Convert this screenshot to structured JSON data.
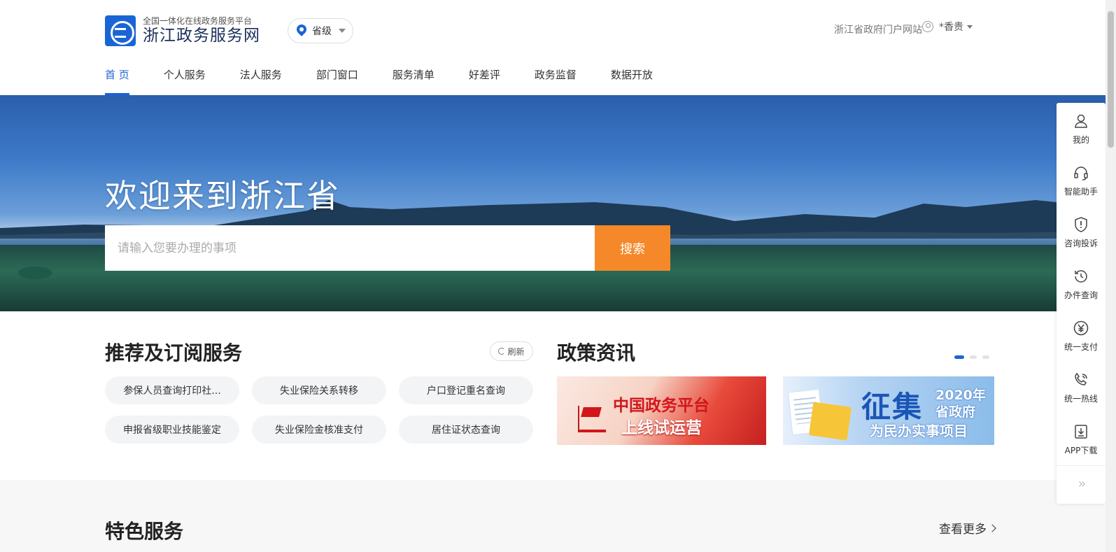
{
  "header": {
    "logo_sub": "全国一体化在线政务服务平台",
    "logo_main": "浙江政务服务网",
    "level_select": "省级",
    "portal_link": "浙江省政府门户网站",
    "username": "*香贵"
  },
  "nav": {
    "items": [
      {
        "label": "首 页",
        "active": true
      },
      {
        "label": "个人服务"
      },
      {
        "label": "法人服务"
      },
      {
        "label": "部门窗口"
      },
      {
        "label": "服务清单"
      },
      {
        "label": "好差评"
      },
      {
        "label": "政务监督"
      },
      {
        "label": "数据开放"
      }
    ]
  },
  "banner": {
    "welcome": "欢迎来到浙江省",
    "search_placeholder": "请输入您要办理的事项",
    "search_button": "搜索"
  },
  "recommend": {
    "title": "推荐及订阅服务",
    "refresh": "刷新",
    "chips": [
      "参保人员查询打印社...",
      "失业保险关系转移",
      "户口登记重名查询",
      "申报省级职业技能鉴定",
      "失业保险金核准支付",
      "居住证状态查询"
    ]
  },
  "policy": {
    "title": "政策资讯",
    "carousel_count": 3,
    "carousel_active": 1,
    "card1": {
      "line1": "中国政务平台",
      "line2": "上线试运营"
    },
    "card2": {
      "big": "征集",
      "year": "2020年",
      "gov": "省政府",
      "sub": "为民办实事项目"
    }
  },
  "features": {
    "title": "特色服务",
    "more": "查看更多"
  },
  "toolbar": {
    "items": [
      {
        "label": "我的",
        "icon": "user-icon"
      },
      {
        "label": "智能助手",
        "icon": "headset-icon"
      },
      {
        "label": "咨询投诉",
        "icon": "shield-alert-icon"
      },
      {
        "label": "办件查询",
        "icon": "history-icon"
      },
      {
        "label": "统一支付",
        "icon": "yuan-icon"
      },
      {
        "label": "统一热线",
        "icon": "phone-icon"
      },
      {
        "label": "APP下载",
        "icon": "download-icon"
      }
    ],
    "collapse": "››"
  },
  "colors": {
    "brand_blue": "#1a65d6",
    "search_orange": "#f5892a"
  }
}
